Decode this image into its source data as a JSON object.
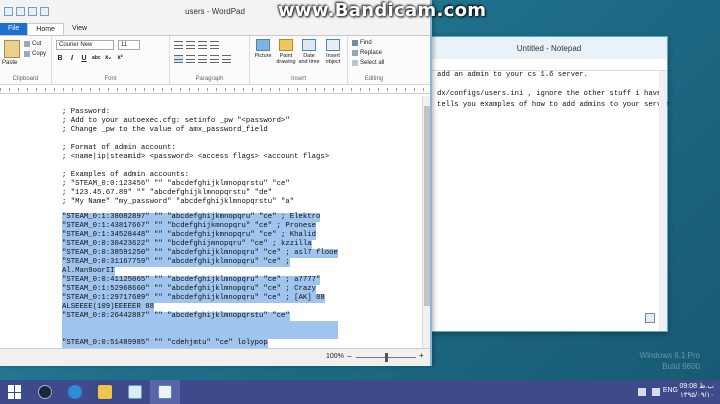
{
  "watermark": "www.Bandicam.com",
  "desktop": {
    "os_edition": "Windows 8.1 Pro",
    "os_build": "Build 9600"
  },
  "notepad": {
    "title": "Untitled - Notepad",
    "lines": [
      "add an admin to your cs 1.6 server.",
      "dx/configs/users.ini , ignore the other stuff i have.",
      "tells you examples of how to add admins to your server"
    ]
  },
  "wordpad": {
    "title": "users - WordPad",
    "tabs": [
      "File",
      "Home",
      "View"
    ],
    "ribbon": {
      "clipboard": {
        "label": "Clipboard",
        "paste": "Paste",
        "cut": "Cut",
        "copy": "Copy"
      },
      "font": {
        "label": "Font",
        "family": "Courier New",
        "size": "11",
        "buttons": [
          "B",
          "I",
          "U",
          "abc",
          "x₂",
          "x²"
        ]
      },
      "paragraph": {
        "label": "Paragraph"
      },
      "insert": {
        "label": "Insert",
        "picture": "Picture",
        "paint": "Paint drawing",
        "datetime": "Date and time",
        "object": "Insert object"
      },
      "editing": {
        "label": "Editing",
        "find": "Find",
        "replace": "Replace",
        "select_all": "Select all"
      }
    },
    "document": {
      "plain_lines": [
        "; Password:",
        "; Add to your autoexec.cfg: setinfo _pw \"<password>\"",
        "; Change _pw to the value of amx_password_field",
        "",
        "; Format of admin account:",
        "; <name|ip|steamid> <password> <access flags> <account flags>",
        "",
        "; Examples of admin accounts:",
        "; \"STEAM_0:0:123456\" \"\" \"abcdefghijklmnopqrstu\" \"ce\"",
        "; \"123.45.67.89\" \"\" \"abcdefghijklmnopqrstu\" \"de\"",
        "; \"My Name\" \"my_password\" \"abcdefghijklmnopqrstu\" \"a\""
      ],
      "selected_lines": [
        "\"STEAM_0:1:38082897\" \"\" \"abcdefghijkmnopqru\" \"ce\" ; Elektro",
        "\"STEAM_0:1:43817667\" \"\" \"bcdefghijkmnopqru\" \"ce\" ; Pronese",
        "\"STEAM_0:1:34528448\" \"\" \"abcdefghijkmnopqru\" \"ce\" ; Khalid",
        "\"STEAM_0:0:30423622\" \"\" \"bcdefghijmnopqru\" \"ce\" ; kzzilla",
        "\"STEAM_0:0:38591250\" \"\" \"abcdefghijklmnopqru\" \"ce\" ; asl7 flooe",
        "\"STEAM_0:0:31167759\" \"\" \"abcdefghijklmnopqru\" \"ce\" ;",
        "Al.Man9oorII",
        "\"STEAM_0:0:41125065\" \"\" \"abcdefghijklmnopqru\" \"ce\" ; a7777\"",
        "\"STEAM_0:1:52968660\" \"\" \"abcdefghijklmnopqru\" \"ce\" ; Crazy",
        "\"STEAM_0:1:29717689\" \"\" \"abcdefghijklmnopqru\" \"ce\" ; [AK] 88",
        "ALSEEEE(109)EEEEER 88",
        "\"STEAM_0:0:26442887\" \"\" \"abcdefghijklmnopqrstu\" \"ce\"",
        "",
        "",
        "\"STEAM_0:0:51489985\" \"\" \"cdehjmtu\" \"ce\" lolypop"
      ]
    },
    "status": {
      "zoom": "100%",
      "zoom_level": 0.5
    }
  },
  "taskbar": {
    "date_time_1": "09:08 ب.ظ",
    "date_time_2": "۱۳۹۵/۰۹/۱۰",
    "lang": "ENG"
  }
}
